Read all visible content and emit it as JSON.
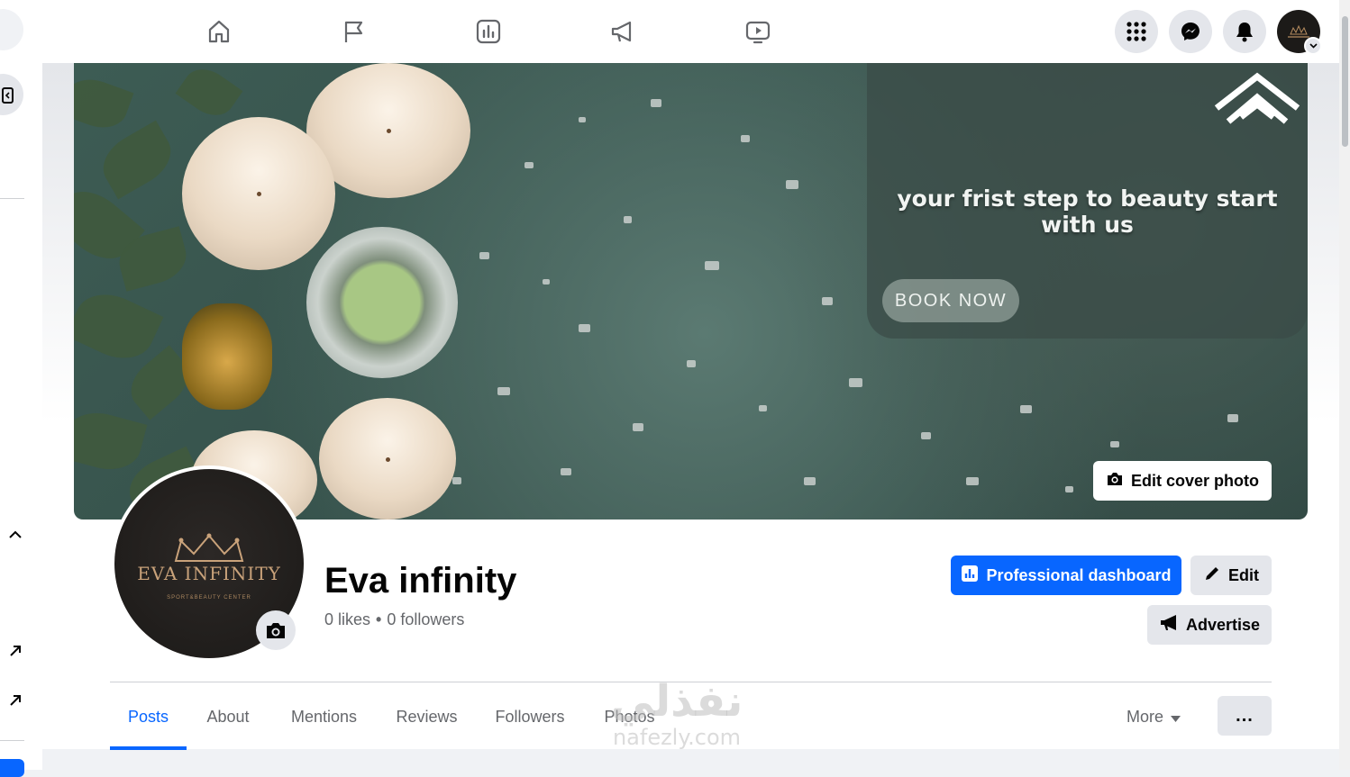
{
  "topnav": {
    "icons": [
      "home-icon",
      "flag-icon",
      "insights-icon",
      "megaphone-icon",
      "video-icon"
    ],
    "right_icons": [
      "menu-grid-icon",
      "messenger-icon",
      "notifications-icon"
    ]
  },
  "cover": {
    "promo_text": "your frist step to beauty start with us",
    "cta_label": "BOOK NOW",
    "edit_label": "Edit cover photo"
  },
  "profile": {
    "logo_name": "EVA INFINITY",
    "logo_tagline": "SPORT&BEAUTY CENTER",
    "name": "Eva infinity",
    "likes": "0 likes",
    "separator": "•",
    "followers": "0 followers"
  },
  "actions": {
    "professional_dashboard": "Professional dashboard",
    "edit": "Edit",
    "advertise": "Advertise"
  },
  "tabs": {
    "posts": "Posts",
    "about": "About",
    "mentions": "Mentions",
    "reviews": "Reviews",
    "followers": "Followers",
    "photos": "Photos",
    "more": "More",
    "overflow": "..."
  },
  "watermark": {
    "arabic": "نفذلي",
    "latin": "nafezly.com"
  },
  "colors": {
    "brand_blue": "#0866ff",
    "button_grey": "#e4e6eb",
    "secondary_text": "#65676b"
  }
}
